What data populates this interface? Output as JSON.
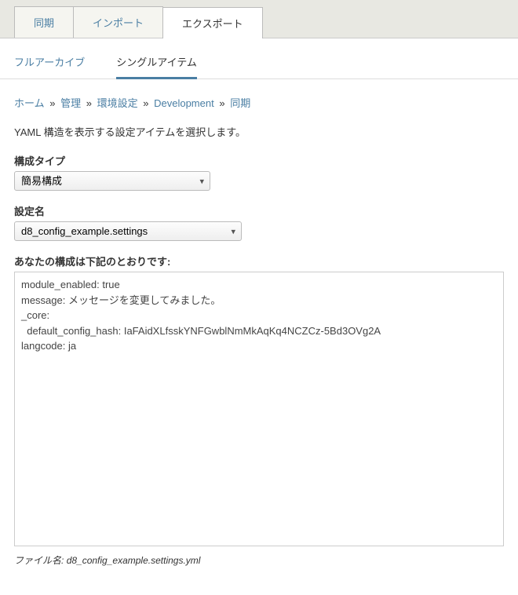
{
  "primaryTabs": {
    "sync": "同期",
    "import": "インポート",
    "export": "エクスポート"
  },
  "secondaryTabs": {
    "fullArchive": "フルアーカイブ",
    "singleItem": "シングルアイテム"
  },
  "breadcrumb": {
    "home": "ホーム",
    "admin": "管理",
    "config": "環境設定",
    "development": "Development",
    "sync": "同期",
    "sep": "»"
  },
  "description": "YAML 構造を表示する設定アイテムを選択します。",
  "form": {
    "configTypeLabel": "構成タイプ",
    "configTypeValue": "簡易構成",
    "configNameLabel": "設定名",
    "configNameValue": "d8_config_example.settings",
    "yamlLabel": "あなたの構成は下記のとおりです:",
    "yamlContent": "module_enabled: true\nmessage: メッセージを変更してみました。\n_core:\n  default_config_hash: IaFAidXLfsskYNFGwblNmMkAqKq4NCZCz-5Bd3OVg2A\nlangcode: ja",
    "filenameLabel": "ファイル名:",
    "filenameValue": "d8_config_example.settings.yml"
  }
}
